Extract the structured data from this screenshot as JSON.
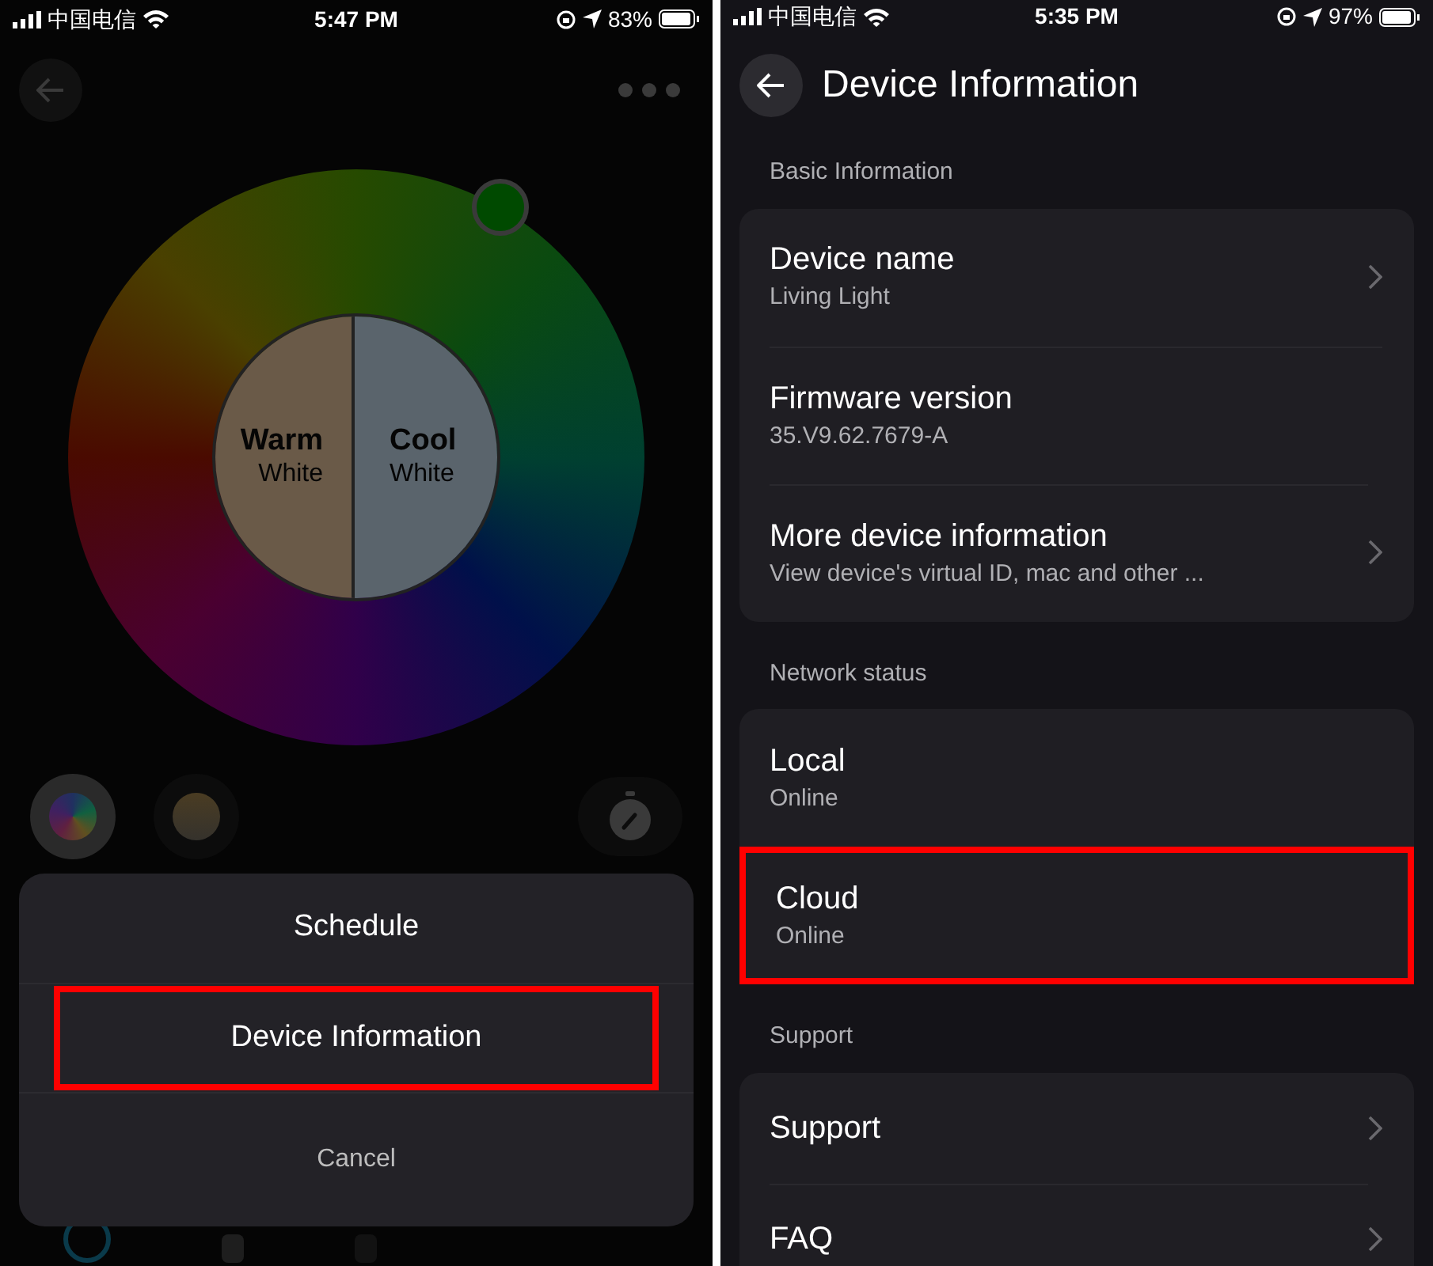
{
  "left_screen": {
    "status_bar": {
      "carrier": "中国电信",
      "time": "5:47 PM",
      "battery": "83%"
    },
    "color_wheel": {
      "halves": [
        {
          "title": "Warm",
          "subtitle": "White"
        },
        {
          "title": "Cool",
          "subtitle": "White"
        }
      ]
    },
    "action_sheet": {
      "items": [
        {
          "label": "Schedule",
          "highlighted": false
        },
        {
          "label": "Device Information",
          "highlighted": true
        }
      ],
      "cancel": "Cancel"
    }
  },
  "right_screen": {
    "status_bar": {
      "carrier": "中国电信",
      "time": "5:35 PM",
      "battery": "97%"
    },
    "title": "Device Information",
    "sections": [
      {
        "heading": "Basic Information",
        "rows": [
          {
            "title": "Device name",
            "subtitle": "Living Light",
            "chevron": true,
            "highlighted": false
          },
          {
            "title": "Firmware version",
            "subtitle": "35.V9.62.7679-A",
            "chevron": false,
            "highlighted": false
          },
          {
            "title": "More device information",
            "subtitle": "View device's virtual ID, mac and other ...",
            "chevron": true,
            "highlighted": false
          }
        ]
      },
      {
        "heading": "Network status",
        "rows": [
          {
            "title": "Local",
            "subtitle": "Online",
            "chevron": false,
            "highlighted": false
          },
          {
            "title": "Cloud",
            "subtitle": "Online",
            "chevron": false,
            "highlighted": true
          }
        ]
      },
      {
        "heading": "Support",
        "rows": [
          {
            "title": "Support",
            "chevron": true,
            "highlighted": false
          },
          {
            "title": "FAQ",
            "chevron": true,
            "highlighted": false
          }
        ]
      }
    ]
  }
}
